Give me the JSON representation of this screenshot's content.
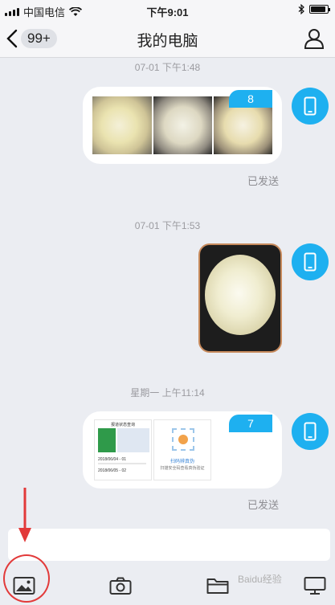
{
  "status_bar": {
    "carrier": "中国电信",
    "time": "下午9:01"
  },
  "nav": {
    "badge": "99+",
    "title": "我的电脑"
  },
  "messages": [
    {
      "timestamp": "07-01 下午1:48",
      "image_count": "8",
      "status": "已发送"
    },
    {
      "timestamp": "07-01 下午1:53"
    },
    {
      "timestamp": "星期一 上午11:14",
      "image_count": "7",
      "status": "已发送"
    }
  ],
  "screenshot_card": {
    "left_title": "报道状态查询",
    "row1_date": "2018/06/04 - 01",
    "row2_date": "2018/06/05 - 02",
    "right_title": "扫码辨真伪",
    "right_desc": "扫描安全码查看真伪验证"
  },
  "colors": {
    "accent": "#1eb0f0",
    "background": "#ebedf2",
    "annotation": "#e23a3a"
  },
  "toolbar": {
    "icons": [
      "image-icon",
      "camera-icon",
      "folder-icon",
      "computer-icon"
    ]
  },
  "watermark": "Baidu经验"
}
